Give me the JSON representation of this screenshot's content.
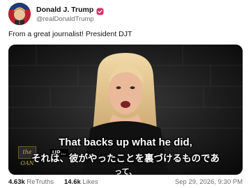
{
  "author": {
    "display_name": "Donald J. Trump",
    "handle": "@realDonaldTrump",
    "badge_color": "#d32f6a"
  },
  "post": {
    "text": "From a great journalist! President DJT"
  },
  "video": {
    "logo_text": "the OAN",
    "lower_third": "UP…",
    "caption_en": "That backs up what he did,",
    "caption_ja_line1": "それは、彼がやったことを裏づけるものであ",
    "caption_ja_line2": "って、"
  },
  "stats": {
    "retruths_count": "4.63k",
    "retruths_label": "ReTruths",
    "likes_count": "14.6k",
    "likes_label": "Likes",
    "timestamp": "Sep 29, 2026, 9:30 PM"
  }
}
